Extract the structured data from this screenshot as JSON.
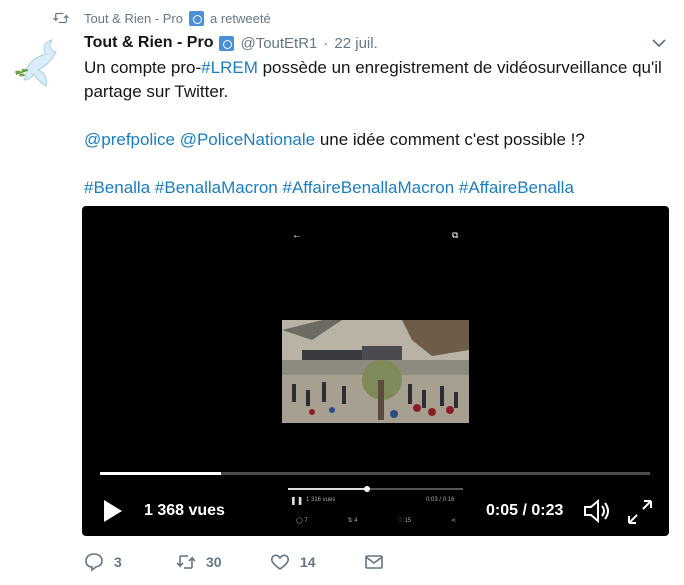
{
  "retweet_context": {
    "account": "Tout & Rien - Pro",
    "action": "a retweeté"
  },
  "tweet": {
    "display_name": "Tout & Rien - Pro",
    "handle": "@ToutEtR1",
    "separator": "·",
    "date": "22 juil.",
    "line1_before": "Un compte pro-",
    "line1_hashtag": "#LREM",
    "line1_after": " possède un enregistrement de vidéosurveillance qu'il",
    "line2": "partage sur Twitter.",
    "mention1": "@prefpolice",
    "mention2": "@PoliceNationale",
    "mention_text": " une idée comment c'est possible !?",
    "hashtags": [
      "#Benalla",
      "#BenallaMacron",
      "#AffaireBenallaMacron",
      "#AffaireBenalla"
    ]
  },
  "video": {
    "views": "1 368 vues",
    "time": "0:05 / 0:23",
    "progress": 0.22,
    "inner_back_icon": "←",
    "inner_pip_icon": "⧉",
    "mini": {
      "views": "1 316 vues",
      "time": "0:03 / 0:16",
      "progress": 0.45,
      "reply_count": "7",
      "retweet_count": "4",
      "like_count": "15"
    }
  },
  "actions": {
    "reply_count": "3",
    "retweet_count": "30",
    "like_count": "14"
  },
  "colors": {
    "link": "#1b7ec2",
    "muted": "#657786",
    "text": "#14171a",
    "video_bg": "#000000"
  }
}
